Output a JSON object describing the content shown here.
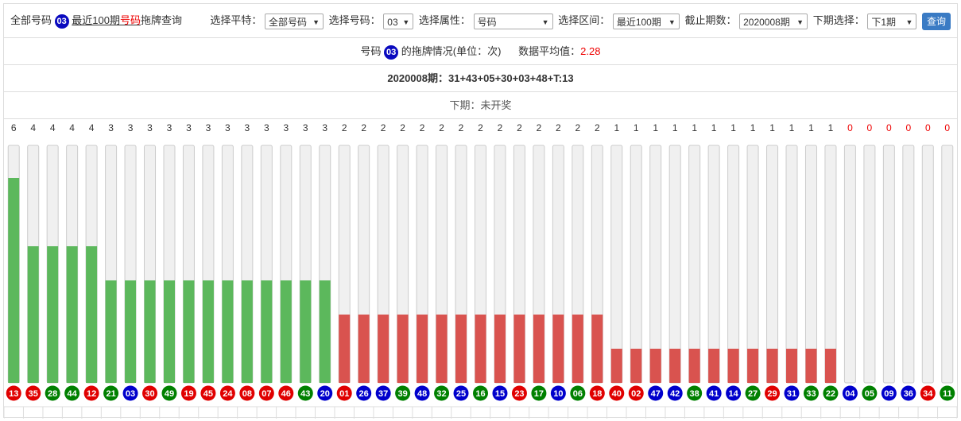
{
  "header": {
    "title_prefix": "全部号码",
    "ball_number": "03",
    "link_text_a": "最近100期",
    "link_text_b": "号码",
    "title_suffix": "拖牌查询"
  },
  "filters": {
    "platform_label": "选择平特：",
    "platform_value": "全部号码",
    "number_label": "选择号码：",
    "number_value": "03",
    "attr_label": "选择属性：",
    "attr_value": "号码",
    "range_label": "选择区间：",
    "range_value": "最近100期",
    "end_label": "截止期数：",
    "end_value": "2020008期",
    "next_label": "下期选择：",
    "next_value": "下1期",
    "query_button": "查询"
  },
  "summary": {
    "prefix": "号码",
    "ball": "03",
    "middle": "的拖牌情况(单位：次)",
    "avg_label": "数据平均值：",
    "avg_value": "2.28"
  },
  "draw_line": "2020008期：31+43+05+30+03+48+T:13",
  "next_line": "下期：未开奖",
  "colors": {
    "green": "#5cb85c",
    "red": "#d9534f",
    "track": "#f0f0f0",
    "ball_red": "#e00000",
    "ball_blue": "#0000cc",
    "ball_green": "#008000"
  },
  "chart_data": {
    "type": "bar",
    "categories": [
      "13",
      "35",
      "28",
      "44",
      "12",
      "21",
      "03",
      "30",
      "49",
      "19",
      "45",
      "24",
      "08",
      "07",
      "46",
      "43",
      "20",
      "01",
      "26",
      "37",
      "39",
      "48",
      "32",
      "25",
      "16",
      "15",
      "23",
      "17",
      "10",
      "06",
      "18",
      "40",
      "02",
      "47",
      "42",
      "38",
      "41",
      "14",
      "27",
      "29",
      "31",
      "33",
      "22",
      "04",
      "05",
      "09",
      "36",
      "34",
      "11"
    ],
    "values": [
      6,
      4,
      4,
      4,
      4,
      3,
      3,
      3,
      3,
      3,
      3,
      3,
      3,
      3,
      3,
      3,
      3,
      2,
      2,
      2,
      2,
      2,
      2,
      2,
      2,
      2,
      2,
      2,
      2,
      2,
      2,
      1,
      1,
      1,
      1,
      1,
      1,
      1,
      1,
      1,
      1,
      1,
      1,
      0,
      0,
      0,
      0,
      0,
      0
    ],
    "ball_colors": [
      "red",
      "red",
      "green",
      "green",
      "red",
      "green",
      "blue",
      "red",
      "green",
      "red",
      "red",
      "red",
      "red",
      "red",
      "red",
      "green",
      "blue",
      "red",
      "blue",
      "blue",
      "green",
      "blue",
      "green",
      "blue",
      "green",
      "blue",
      "red",
      "green",
      "blue",
      "green",
      "red",
      "red",
      "red",
      "blue",
      "blue",
      "green",
      "blue",
      "blue",
      "green",
      "red",
      "blue",
      "green",
      "green",
      "blue",
      "green",
      "blue",
      "blue",
      "red",
      "green"
    ],
    "ymax": 7
  }
}
